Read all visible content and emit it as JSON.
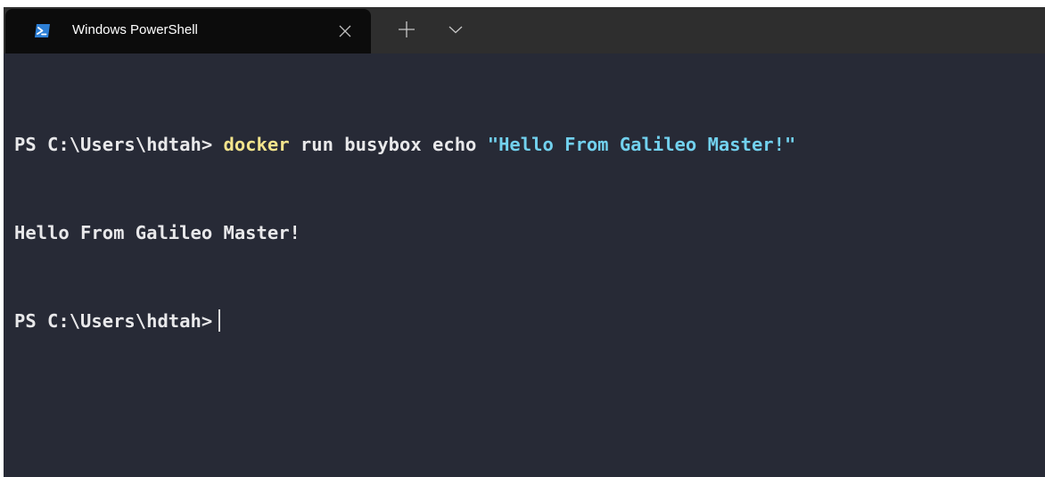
{
  "tab": {
    "icon": "powershell-icon",
    "title": "Windows PowerShell",
    "close_icon": "close-icon"
  },
  "tabbar": {
    "new_tab_icon": "plus-icon",
    "dropdown_icon": "chevron-down-icon"
  },
  "terminal": {
    "line1": {
      "prompt": "PS C:\\Users\\hdtah> ",
      "command": "docker",
      "args": " run busybox echo ",
      "string": "\"Hello From Galileo Master!\""
    },
    "line2": {
      "output": "Hello From Galileo Master!"
    },
    "line3": {
      "prompt": "PS C:\\Users\\hdtah>"
    }
  },
  "colors": {
    "background": "#272a36",
    "tabbar": "#2e2e2e",
    "active_tab": "#0c0c0c",
    "text": "#e8e8ea",
    "command": "#f3e48c",
    "string": "#72d1ee",
    "icon_blue": "#2d7fd6"
  }
}
